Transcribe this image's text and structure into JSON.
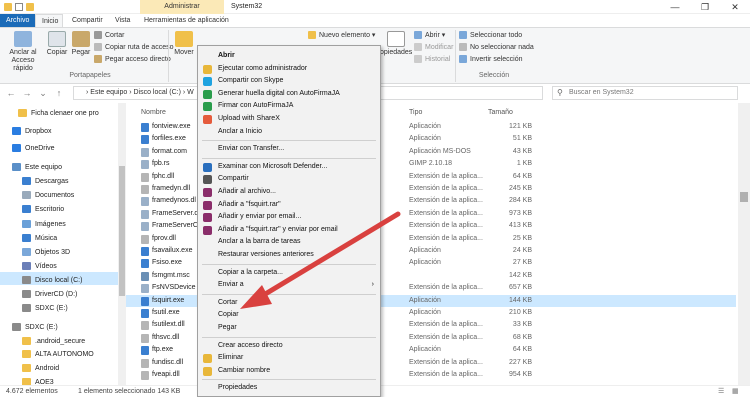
{
  "window": {
    "admin_tab": "Administrar",
    "title": "System32",
    "controls": [
      "—",
      "❐",
      "✕"
    ]
  },
  "ribbon": {
    "tabs": [
      "Archivo",
      "Inicio",
      "Compartir",
      "Vista",
      "Herramientas de aplicación"
    ],
    "pin_label": "Anclar al Acceso rápido",
    "copy_label": "Copiar",
    "paste_label": "Pegar",
    "cut_label": "Cortar",
    "copy_path_label": "Copiar ruta de acceso",
    "paste_shortcut_label": "Pegar acceso directo",
    "clipboard_group": "Portapapeles",
    "move_label": "Mover",
    "new_item_label": "Nuevo elemento ▾",
    "properties_label": "opiedades",
    "open_label": "Abrir ▾",
    "modify_label": "Modificar",
    "history_label": "Historial",
    "select_all": "Seleccionar todo",
    "select_none": "No seleccionar nada",
    "invert_selection": "Invertir selección",
    "select_group": "Selección"
  },
  "address": {
    "path": "› Este equipo › Disco local (C:) › W",
    "search_placeholder": "Buscar en System32"
  },
  "columns": {
    "name": "Nombre",
    "type": "Tipo",
    "size": "Tamaño"
  },
  "nav": [
    {
      "label": "Ficha clenaer one pro",
      "icon": "folder-icon"
    },
    {
      "label": "Dropbox",
      "icon": "dropbox-icon"
    },
    {
      "label": "OneDrive",
      "icon": "onedrive-icon"
    },
    {
      "label": "Este equipo",
      "icon": "computer-icon"
    },
    {
      "label": "Descargas",
      "icon": "downloads-icon"
    },
    {
      "label": "Documentos",
      "icon": "documents-icon"
    },
    {
      "label": "Escritorio",
      "icon": "desktop-icon"
    },
    {
      "label": "Imágenes",
      "icon": "pictures-icon"
    },
    {
      "label": "Música",
      "icon": "music-icon"
    },
    {
      "label": "Objetos 3D",
      "icon": "objects-3d-icon"
    },
    {
      "label": "Vídeos",
      "icon": "videos-icon"
    },
    {
      "label": "Disco local (C:)",
      "icon": "drive-icon"
    },
    {
      "label": "DriverCD (D:)",
      "icon": "drive-icon"
    },
    {
      "label": "SDXC (E:)",
      "icon": "sd-card-icon"
    },
    {
      "label": "SDXC (E:)",
      "icon": "sd-card-icon"
    },
    {
      "label": ".android_secure",
      "icon": "folder-icon"
    },
    {
      "label": "ALTA AUTONOMO",
      "icon": "folder-icon"
    },
    {
      "label": "Android",
      "icon": "folder-icon"
    },
    {
      "label": "AOE3",
      "icon": "folder-icon"
    }
  ],
  "files": [
    {
      "name": "fontview.exe",
      "type": "Aplicación",
      "size": "121 KB"
    },
    {
      "name": "forfiles.exe",
      "type": "Aplicación",
      "size": "51 KB"
    },
    {
      "name": "format.com",
      "type": "Aplicación MS-DOS",
      "size": "43 KB"
    },
    {
      "name": "fpb.rs",
      "type": "GIMP 2.10.18",
      "size": "1 KB"
    },
    {
      "name": "fphc.dll",
      "type": "Extensión de la aplica...",
      "size": "64 KB"
    },
    {
      "name": "framedyn.dll",
      "type": "Extensión de la aplica...",
      "size": "245 KB"
    },
    {
      "name": "framedynos.dl",
      "type": "Extensión de la aplica...",
      "size": "284 KB"
    },
    {
      "name": "FrameServer.d",
      "type": "Extensión de la aplica...",
      "size": "973 KB"
    },
    {
      "name": "FrameServerCl",
      "type": "Extensión de la aplica...",
      "size": "413 KB"
    },
    {
      "name": "fprov.dll",
      "type": "Extensión de la aplica...",
      "size": "25 KB"
    },
    {
      "name": "fsavailux.exe",
      "type": "Aplicación",
      "size": "24 KB"
    },
    {
      "name": "Fsiso.exe",
      "type": "Aplicación",
      "size": "27 KB"
    },
    {
      "name": "fsmgmt.msc",
      "type": "",
      "size": "142 KB"
    },
    {
      "name": "FsNVSDevice",
      "type": "Extensión de la aplica...",
      "size": "657 KB"
    },
    {
      "name": "fsquirt.exe",
      "type": "Aplicación",
      "size": "144 KB"
    },
    {
      "name": "fsutil.exe",
      "type": "Aplicación",
      "size": "210 KB"
    },
    {
      "name": "fsutilext.dll",
      "type": "Extensión de la aplica...",
      "size": "33 KB"
    },
    {
      "name": "fthsvc.dll",
      "type": "Extensión de la aplica...",
      "size": "68 KB"
    },
    {
      "name": "ftp.exe",
      "type": "Aplicación",
      "size": "64 KB"
    },
    {
      "name": "fundisc.dll",
      "type": "Extensión de la aplica...",
      "size": "227 KB"
    },
    {
      "name": "fveapi.dll",
      "type": "Extensión de la aplica...",
      "size": "954 KB"
    }
  ],
  "status": {
    "count": "4.672 elementos",
    "selected": "1 elemento seleccionado  143 KB"
  },
  "menu": [
    {
      "label": "Abrir",
      "icon": "",
      "bold": true
    },
    {
      "label": "Ejecutar como administrador",
      "icon": "shield-icon"
    },
    {
      "label": "Compartir con Skype",
      "icon": "skype-icon"
    },
    {
      "label": "Generar huella digital con AutoFirmaJA",
      "icon": "autofirma-icon"
    },
    {
      "label": "Firmar con AutoFirmaJA",
      "icon": "autofirma-icon"
    },
    {
      "label": "Upload with ShareX",
      "icon": "sharex-icon"
    },
    {
      "label": "Anclar a Inicio",
      "icon": ""
    },
    {
      "label": "Enviar con Transfer...",
      "icon": "",
      "sep_before": true
    },
    {
      "label": "Examinar con Microsoft Defender...",
      "icon": "defender-icon",
      "sep_before": true
    },
    {
      "label": "Compartir",
      "icon": "share-icon"
    },
    {
      "label": "Añadir al archivo...",
      "icon": "winrar-icon"
    },
    {
      "label": "Añadir a \"fsquirt.rar\"",
      "icon": "winrar-icon"
    },
    {
      "label": "Añadir y enviar por email...",
      "icon": "winrar-icon"
    },
    {
      "label": "Añadir a \"fsquirt.rar\" y enviar por email",
      "icon": "winrar-icon"
    },
    {
      "label": "Anclar a la barra de tareas",
      "icon": ""
    },
    {
      "label": "Restaurar versiones anteriores",
      "icon": ""
    },
    {
      "label": "Copiar a la carpeta...",
      "icon": "",
      "sep_before": true
    },
    {
      "label": "Enviar a",
      "icon": "",
      "submenu": true
    },
    {
      "label": "Cortar",
      "icon": "",
      "sep_before": true
    },
    {
      "label": "Copiar",
      "icon": ""
    },
    {
      "label": "Pegar",
      "icon": ""
    },
    {
      "label": "Crear acceso directo",
      "icon": "",
      "sep_before": true
    },
    {
      "label": "Eliminar",
      "icon": "shield-icon"
    },
    {
      "label": "Cambiar nombre",
      "icon": "shield-icon"
    },
    {
      "label": "Propiedades",
      "icon": "",
      "sep_before": true
    }
  ],
  "colors": {
    "accent": "#1b6bb8",
    "selection": "#cce8ff",
    "arrow": "#d9413f"
  }
}
